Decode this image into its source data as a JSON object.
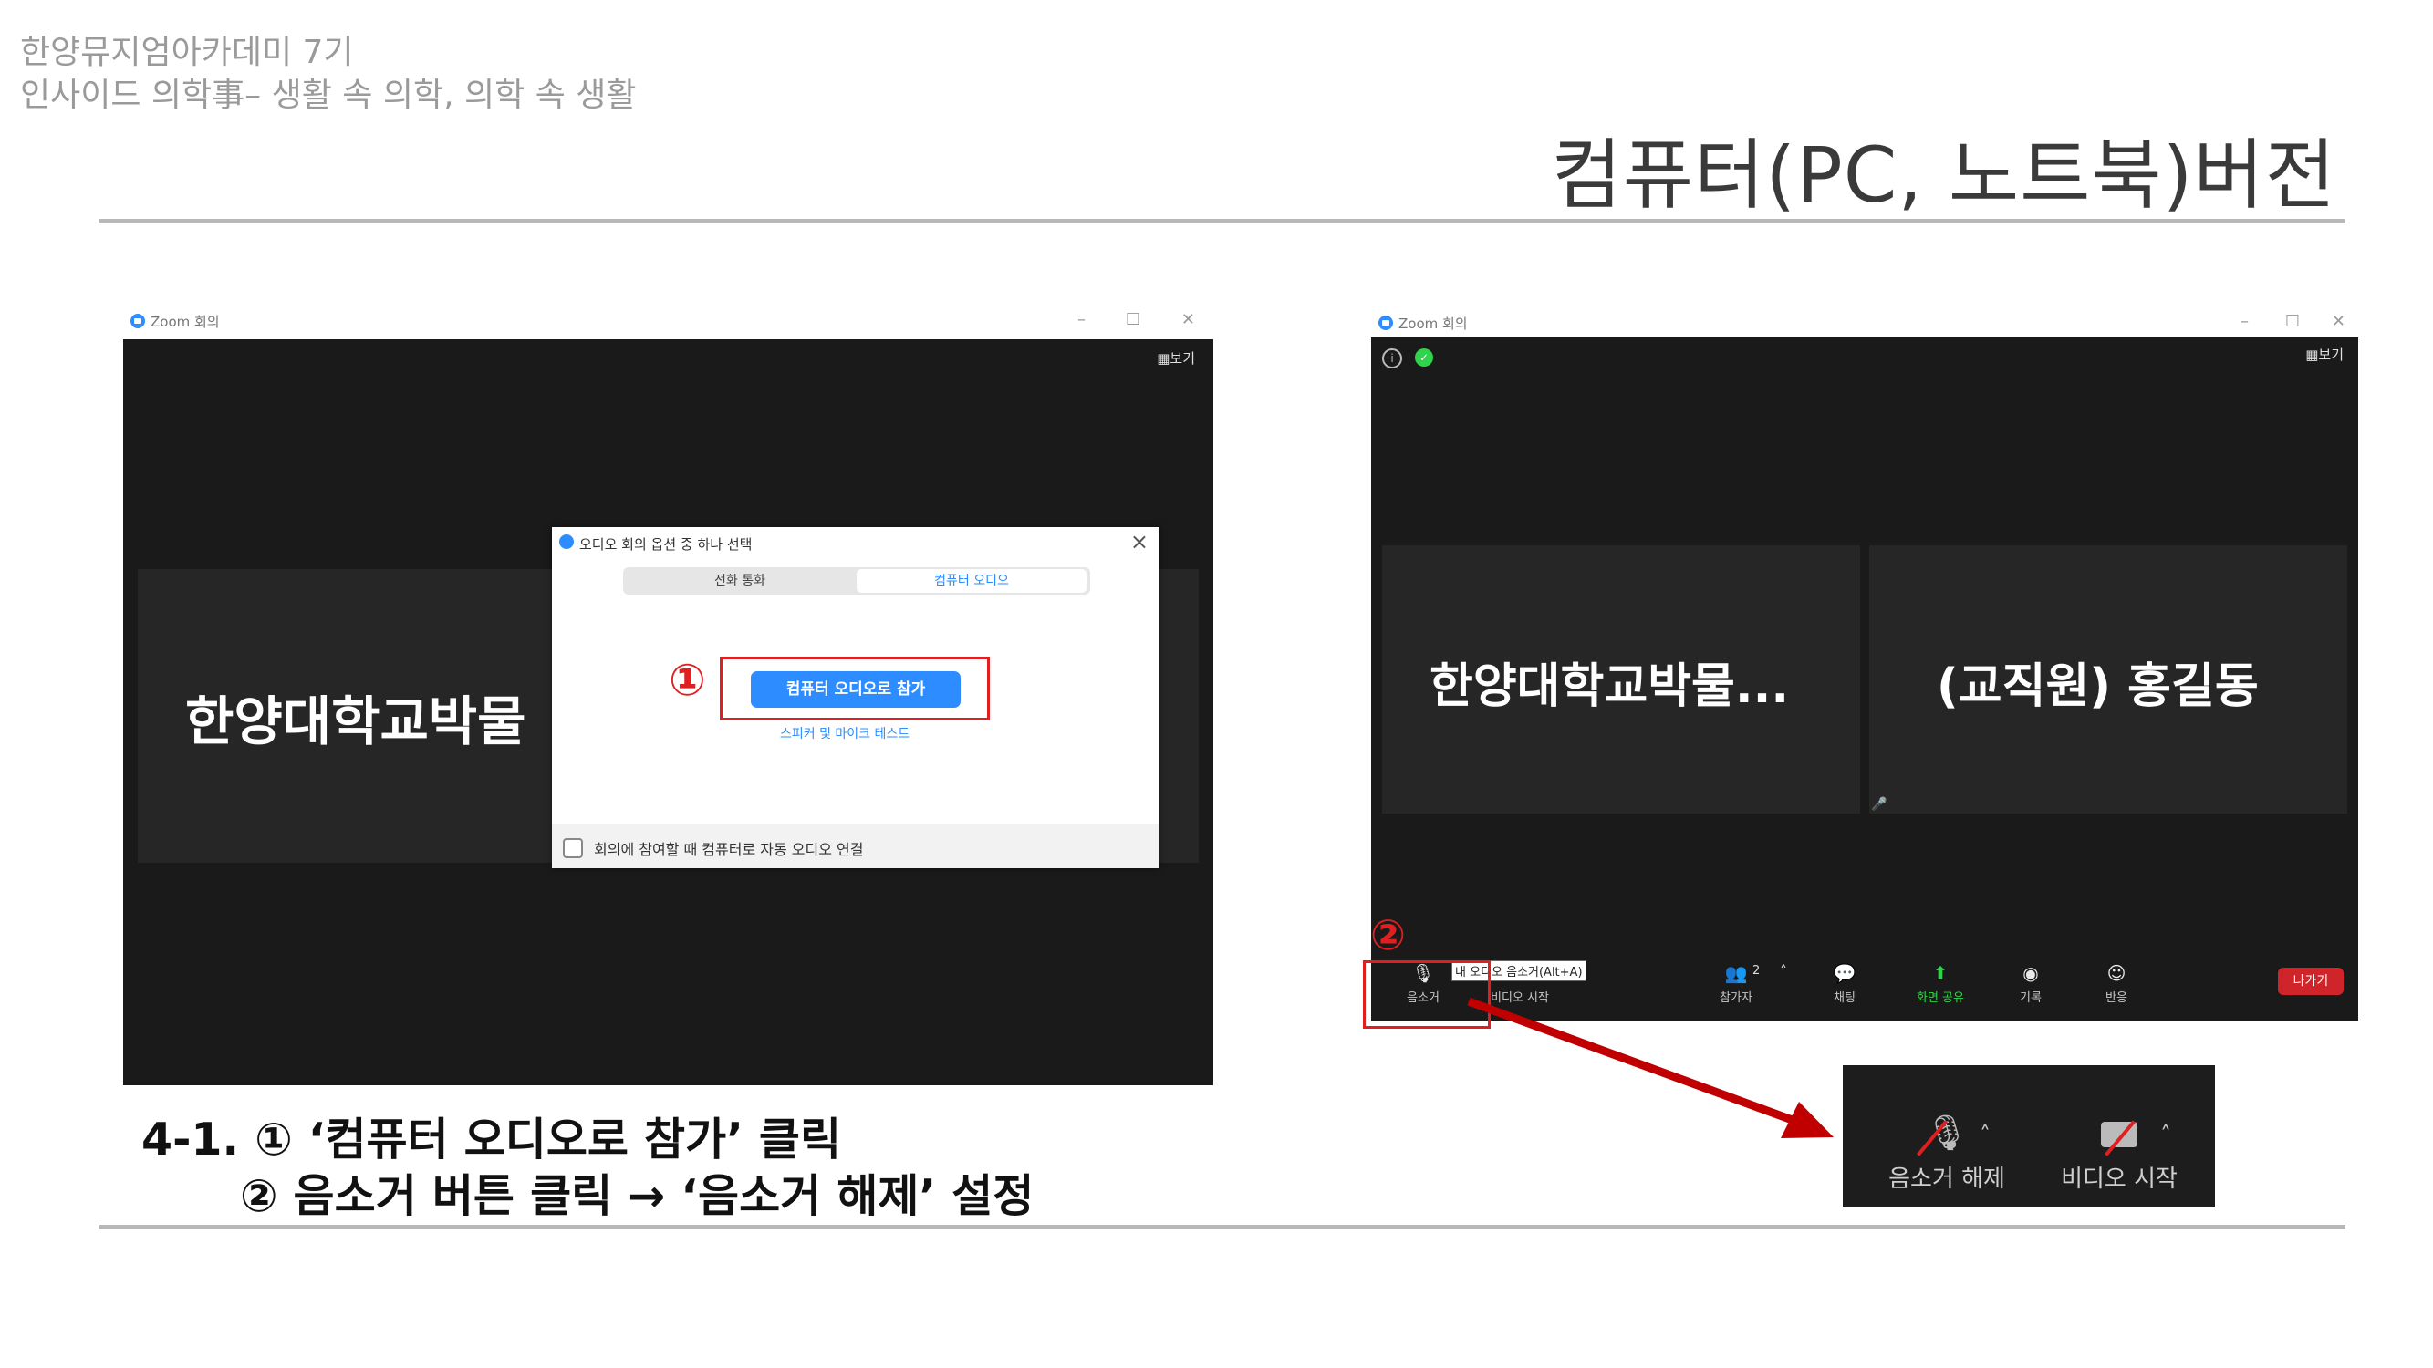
{
  "header": {
    "line1": "한양뮤지엄아카데미 7기",
    "line2": "인사이드 의학事– 생활 속 의학, 의학 속 생활",
    "page_title": "컴퓨터(PC, 노트북)버전"
  },
  "left_window": {
    "title": "Zoom 회의",
    "view_label": "보기",
    "tile_name": "한양대학교박물",
    "dialog": {
      "title": "오디오 회의 옵션 중 하나 선택",
      "close": "×",
      "tab_phone": "전화 통화",
      "tab_computer": "컴퓨터 오디오",
      "join_button": "컴퓨터 오디오로 참가",
      "test_link": "스피커 및 마이크 테스트",
      "auto_connect_label": "회의에 참여할 때 컴퓨터로 자동 오디오 연결"
    },
    "marker": "①"
  },
  "right_window": {
    "title": "Zoom 회의",
    "view_label": "보기",
    "tile1_name": "한양대학교박물...",
    "tile2_name": "(교직원) 홍길동",
    "marker": "②",
    "toolbar": {
      "mute": "음소거",
      "video": "비디오 시작",
      "tooltip": "내 오디오 음소거(Alt+A)",
      "participants": "참가자",
      "participants_count": "2",
      "chat": "채팅",
      "share": "화면 공유",
      "record": "기록",
      "reactions": "반응",
      "leave": "나가기"
    }
  },
  "inset": {
    "unmute": "음소거 해제",
    "start_video": "비디오 시작"
  },
  "caption": {
    "line1": "4-1. ① ‘컴퓨터 오디오로 참가’ 클릭",
    "line2": "② 음소거 버튼 클릭 → ‘음소거 해제’ 설정"
  },
  "colors": {
    "zoom_blue": "#2d8cff",
    "annotation_red": "#e02020",
    "arrow_red": "#c00000",
    "leave_red": "#d0242b",
    "share_green": "#2fd44a"
  }
}
